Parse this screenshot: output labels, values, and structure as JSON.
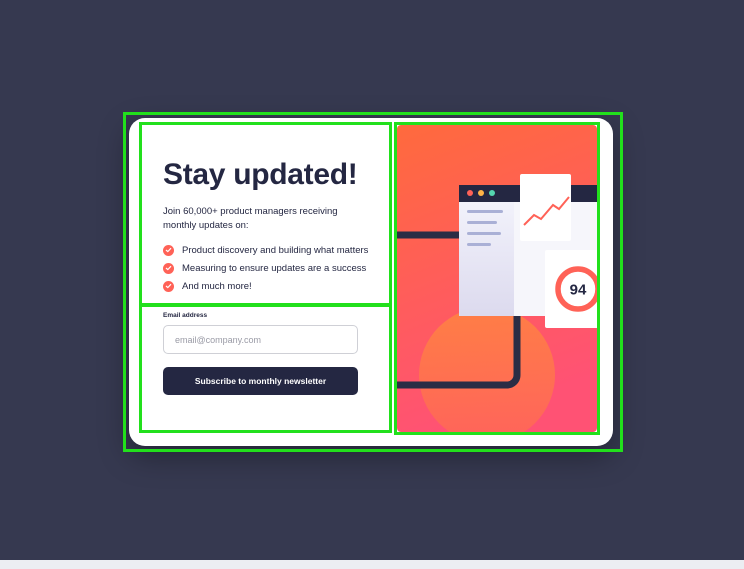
{
  "card": {
    "title": "Stay updated!",
    "subtitle": "Join 60,000+ product managers receiving monthly updates on:",
    "features": [
      "Product discovery and building what matters",
      "Measuring to ensure updates are a success",
      "And much more!"
    ]
  },
  "form": {
    "email_label": "Email address",
    "email_placeholder": "email@company.com",
    "submit_label": "Subscribe to monthly newsletter"
  },
  "illustration": {
    "score": "94"
  },
  "colors": {
    "background": "#363950",
    "dark_navy": "#242742",
    "tomato": "#ff6257",
    "overlay_green": "#22e01c"
  }
}
